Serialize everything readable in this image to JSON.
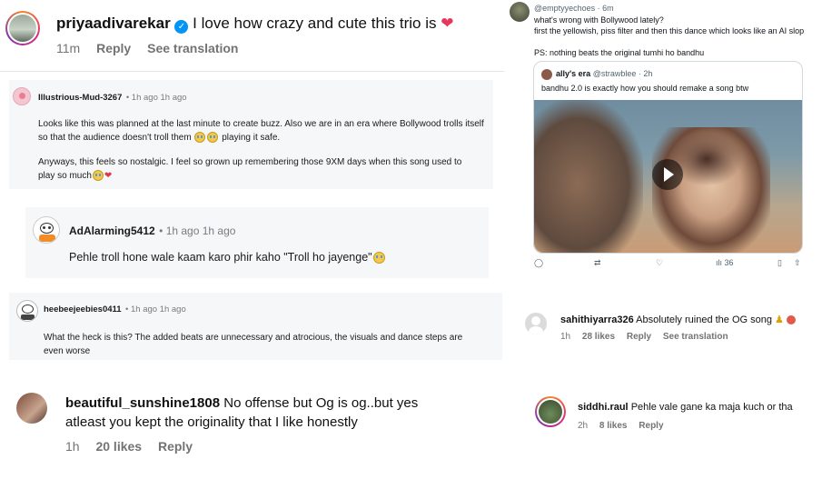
{
  "ig_top": {
    "username": "priyaadivarekar",
    "comment": "I love how crazy and cute this trio is",
    "time": "11m",
    "reply": "Reply",
    "see_translation": "See translation"
  },
  "reddit1": {
    "username": "Illustrious-Mud-3267",
    "time": "• 1h ago 1h ago",
    "para1": "Looks like this was planned at the last minute to create buzz. Also we are in an era where Bollywood trolls itself so that the audience doesn't troll them",
    "para1_end": "playing it safe.",
    "para2_a": "Anyways, this feels so nostalgic. I feel so grown up remembering those 9XM days when this song used to",
    "para2_b": "play so much"
  },
  "reddit2": {
    "username": "AdAlarming5412",
    "time": "• 1h ago 1h ago",
    "body": "Pehle troll hone wale kaam karo phir kaho \"Troll ho jayenge\""
  },
  "reddit3": {
    "username": "heebeejeebies0411",
    "time": "• 1h ago 1h ago",
    "body_a": "What the heck is this? The added beats are unnecessary and atrocious, the visuals and dance steps are",
    "body_b": "even worse"
  },
  "ig_bottom_left": {
    "username": "beautiful_sunshine1808",
    "comment_a": "No offense but Og is og..but yes",
    "comment_b": "atleast you kept the originality that I like honestly",
    "time": "1h",
    "likes": "20 likes",
    "reply": "Reply"
  },
  "tweet": {
    "handle": "@emptyyechoes · 6m",
    "line1": "what's wrong with Bollywood lately?",
    "line2": "first the yellowish, piss filter and then this dance which looks like an AI slop",
    "line3": "PS: nothing beats the original tumhi ho bandhu",
    "quote_name": "ally's era",
    "quote_handle": "@strawblee · 2h",
    "quote_text": "bandhu 2.0 is exactly how you should remake a song btw",
    "views": "36"
  },
  "ig_right1": {
    "username": "sahithiyarra326",
    "comment": "Absolutely ruined the OG song",
    "time": "1h",
    "likes": "28 likes",
    "reply": "Reply",
    "see_translation": "See translation"
  },
  "ig_right2": {
    "username": "siddhi.raul",
    "comment": "Pehle vale gane ka maja kuch or tha",
    "time": "2h",
    "likes": "8 likes",
    "reply": "Reply"
  },
  "colors": {
    "verified_blue": "#0095f6",
    "reddit_card_bg": "#f6f7f8",
    "heart": "#e8365d"
  }
}
